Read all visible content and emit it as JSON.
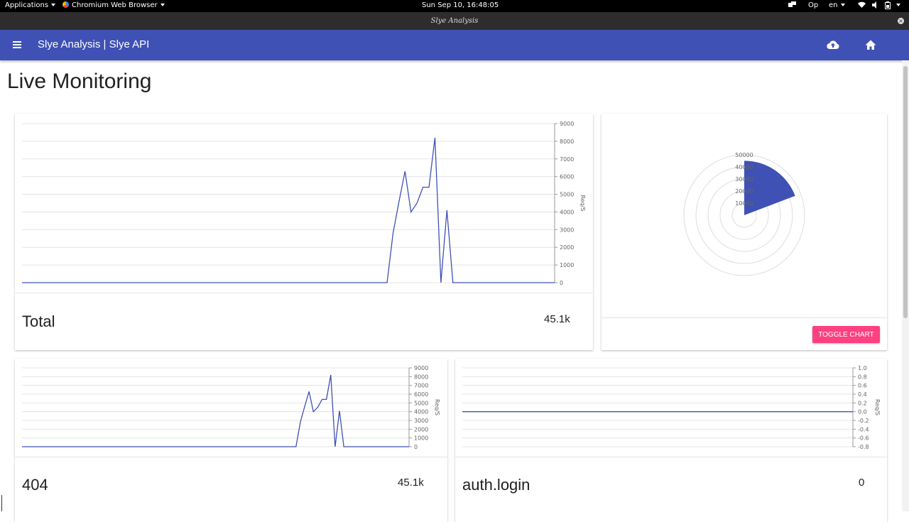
{
  "system_bar": {
    "applications": "Applications",
    "browser": "Chromium Web Browser",
    "clock": "Sun Sep 10, 16:48:05",
    "op": "Op",
    "language": "en"
  },
  "window": {
    "title": "Slye Analysis"
  },
  "app_bar": {
    "title": "Slye Analysis | Slye API",
    "upload_icon": "cloud-upload-icon",
    "home_icon": "home-icon",
    "color": "#3f51b5"
  },
  "page": {
    "title": "Live Monitoring"
  },
  "cards": {
    "total": {
      "title": "Total",
      "value": "45.1k"
    },
    "c404": {
      "title": "404",
      "value": "45.1k"
    },
    "auth_login": {
      "title": "auth.login",
      "value": "0"
    },
    "polar": {
      "toggle_label": "TOGGLE CHART"
    }
  },
  "accent_color": "#ff4081",
  "chart_data": [
    {
      "type": "line",
      "ylabel": "Req/S",
      "ylim": [
        0,
        9000
      ],
      "yticks": [
        0,
        1000,
        2000,
        3000,
        4000,
        5000,
        6000,
        7000,
        8000,
        9000
      ],
      "grid": true,
      "x": [
        0,
        1,
        2,
        3,
        4,
        5,
        6,
        7,
        8,
        9,
        10,
        11,
        12,
        13,
        14,
        15,
        16,
        17,
        18,
        19,
        20,
        21,
        22,
        23,
        24,
        25,
        26,
        27,
        28,
        29,
        30,
        31,
        32,
        33,
        34,
        35,
        36,
        37,
        38,
        39,
        40,
        41,
        42,
        43,
        44,
        45,
        46,
        47,
        48,
        49,
        50,
        51,
        52,
        53,
        54,
        55,
        56,
        57,
        58,
        59,
        60,
        61,
        62,
        63,
        64,
        65,
        66,
        67,
        68,
        69,
        70,
        71,
        72,
        73,
        74,
        75,
        76,
        77,
        78,
        79,
        80,
        81,
        82,
        83,
        84,
        85,
        86,
        87,
        88,
        89
      ],
      "series": [
        {
          "values": [
            0,
            0,
            0,
            0,
            0,
            0,
            0,
            0,
            0,
            0,
            0,
            0,
            0,
            0,
            0,
            0,
            0,
            0,
            0,
            0,
            0,
            0,
            0,
            0,
            0,
            0,
            0,
            0,
            0,
            0,
            0,
            0,
            0,
            0,
            0,
            0,
            0,
            0,
            0,
            0,
            0,
            0,
            0,
            0,
            0,
            0,
            0,
            0,
            0,
            0,
            0,
            0,
            0,
            0,
            0,
            0,
            0,
            0,
            0,
            0,
            0,
            0,
            2800,
            4600,
            6300,
            4000,
            4500,
            5400,
            5400,
            8200,
            0,
            4100,
            0,
            0,
            0,
            0,
            0,
            0,
            0,
            0,
            0,
            0,
            0,
            0,
            0,
            0,
            0,
            0,
            0,
            0
          ]
        }
      ]
    },
    {
      "type": "polar",
      "rticks": [
        10000,
        20000,
        30000,
        40000,
        50000
      ],
      "rlim": [
        0,
        50000
      ],
      "series": [
        {
          "values": [
            45100
          ]
        }
      ],
      "color": "#3f51b5"
    },
    {
      "type": "line",
      "ylabel": "Req/S",
      "ylim": [
        0,
        9000
      ],
      "yticks": [
        0,
        1000,
        2000,
        3000,
        4000,
        5000,
        6000,
        7000,
        8000,
        9000
      ],
      "grid": true,
      "x": [
        0,
        1,
        2,
        3,
        4,
        5,
        6,
        7,
        8,
        9,
        10,
        11,
        12,
        13,
        14,
        15,
        16,
        17,
        18,
        19,
        20,
        21,
        22,
        23,
        24,
        25,
        26,
        27,
        28,
        29,
        30,
        31,
        32,
        33,
        34,
        35,
        36,
        37,
        38,
        39,
        40,
        41,
        42,
        43,
        44,
        45,
        46,
        47,
        48,
        49,
        50,
        51,
        52,
        53,
        54,
        55,
        56,
        57,
        58,
        59,
        60,
        61,
        62,
        63,
        64,
        65,
        66,
        67,
        68,
        69,
        70,
        71,
        72,
        73,
        74,
        75,
        76,
        77,
        78,
        79,
        80,
        81,
        82,
        83,
        84,
        85,
        86,
        87,
        88,
        89
      ],
      "series": [
        {
          "values": [
            0,
            0,
            0,
            0,
            0,
            0,
            0,
            0,
            0,
            0,
            0,
            0,
            0,
            0,
            0,
            0,
            0,
            0,
            0,
            0,
            0,
            0,
            0,
            0,
            0,
            0,
            0,
            0,
            0,
            0,
            0,
            0,
            0,
            0,
            0,
            0,
            0,
            0,
            0,
            0,
            0,
            0,
            0,
            0,
            0,
            0,
            0,
            0,
            0,
            0,
            0,
            0,
            0,
            0,
            0,
            0,
            0,
            0,
            0,
            0,
            0,
            0,
            0,
            0,
            2800,
            4600,
            6300,
            4000,
            4500,
            5400,
            5400,
            8200,
            0,
            4100,
            0,
            0,
            0,
            0,
            0,
            0,
            0,
            0,
            0,
            0,
            0,
            0,
            0,
            0,
            0,
            0
          ]
        }
      ]
    },
    {
      "type": "line",
      "ylabel": "Req/S",
      "ylim": [
        -0.8,
        1.0
      ],
      "yticks": [
        -0.8,
        -0.6,
        -0.4,
        -0.2,
        0,
        0.2,
        0.4,
        0.6,
        0.8,
        1.0
      ],
      "grid": true,
      "x": [
        0,
        1,
        2,
        3,
        4,
        5,
        6,
        7,
        8,
        9,
        10
      ],
      "series": [
        {
          "values": [
            0,
            0,
            0,
            0,
            0,
            0,
            0,
            0,
            0,
            0,
            0
          ]
        }
      ]
    }
  ]
}
